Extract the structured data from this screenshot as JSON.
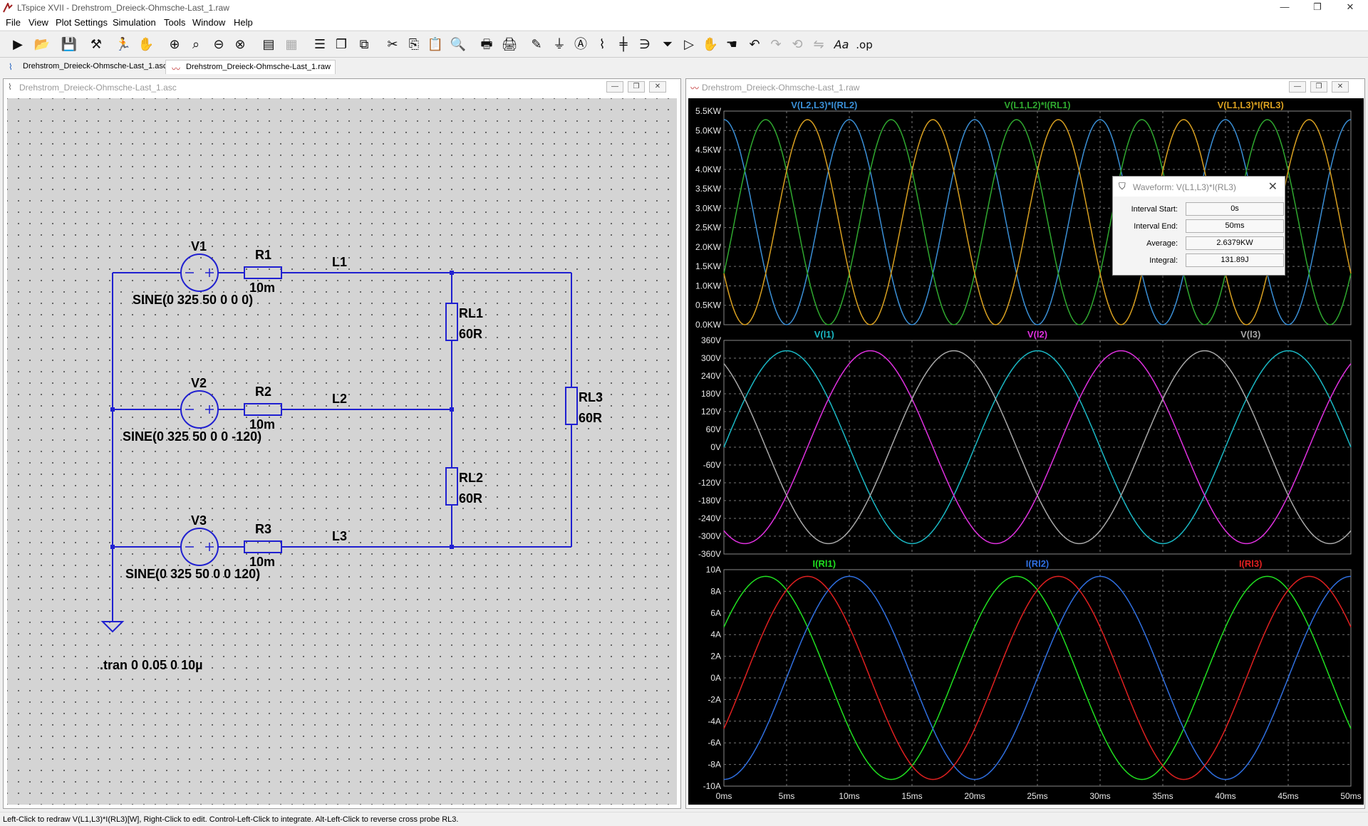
{
  "window": {
    "title": "LTspice XVII - Drehstrom_Dreieck-Ohmsche-Last_1.raw",
    "minimize": "—",
    "maximize": "❐",
    "close": "✕"
  },
  "menu": [
    "File",
    "View",
    "Plot Settings",
    "Simulation",
    "Tools",
    "Window",
    "Help"
  ],
  "doc_tabs": [
    {
      "label": "Drehstrom_Dreieck-Ohmsche-Last_1.asc",
      "icon": "schematic-icon"
    },
    {
      "label": "Drehstrom_Dreieck-Ohmsche-Last_1.raw",
      "icon": "waveform-icon"
    }
  ],
  "schematic_window": {
    "title": "Drehstrom_Dreieck-Ohmsche-Last_1.asc",
    "components": {
      "V1": {
        "name": "V1",
        "value": "SINE(0 325 50 0 0 0)"
      },
      "V2": {
        "name": "V2",
        "value": "SINE(0 325 50 0 0 -120)"
      },
      "V3": {
        "name": "V3",
        "value": "SINE(0 325 50 0 0 120)"
      },
      "R1": {
        "name": "R1",
        "value": "10m"
      },
      "R2": {
        "name": "R2",
        "value": "10m"
      },
      "R3": {
        "name": "R3",
        "value": "10m"
      },
      "RL1": {
        "name": "RL1",
        "value": "60R"
      },
      "RL2": {
        "name": "RL2",
        "value": "60R"
      },
      "RL3": {
        "name": "RL3",
        "value": "60R"
      }
    },
    "nets": {
      "L1": "L1",
      "L2": "L2",
      "L3": "L3"
    },
    "directive": ".tran 0 0.05 0 10µ"
  },
  "plot_window": {
    "title": "Drehstrom_Dreieck-Ohmsche-Last_1.raw"
  },
  "waveform_dialog": {
    "title": "Waveform: V(L1,L3)*I(RL3)",
    "rows": [
      {
        "label": "Interval Start:",
        "value": "0s"
      },
      {
        "label": "Interval End:",
        "value": "50ms"
      },
      {
        "label": "Average:",
        "value": "2.6379KW"
      },
      {
        "label": "Integral:",
        "value": "131.89J"
      }
    ]
  },
  "status_bar": "Left-Click to redraw V(L1,L3)*I(RL3)[W],  Right-Click to edit. Control-Left-Click to integrate. Alt-Left-Click to reverse cross probe RL3.",
  "chart_data": [
    {
      "type": "line",
      "pane": "power",
      "x_range": [
        0,
        50
      ],
      "x_unit": "ms",
      "x_ticks": [
        "0ms",
        "5ms",
        "10ms",
        "15ms",
        "20ms",
        "25ms",
        "30ms",
        "35ms",
        "40ms",
        "45ms",
        "50ms"
      ],
      "y_range": [
        0,
        5.5
      ],
      "y_unit": "KW",
      "y_ticks": [
        "5.5KW",
        "5.0KW",
        "4.5KW",
        "4.0KW",
        "3.5KW",
        "3.0KW",
        "2.5KW",
        "2.0KW",
        "1.5KW",
        "1.0KW",
        "0.5KW",
        "0.0KW"
      ],
      "grid": true,
      "series": [
        {
          "name": "V(L2,L3)*I(RL2)",
          "color": "#3a8fd6",
          "form": "sin_squared",
          "peak": 5.28,
          "phase_deg": 90
        },
        {
          "name": "V(L1,L2)*I(RL1)",
          "color": "#2fa82f",
          "form": "sin_squared",
          "peak": 5.28,
          "phase_deg": 30
        },
        {
          "name": "V(L1,L3)*I(RL3)",
          "color": "#d9a020",
          "form": "sin_squared",
          "peak": 5.28,
          "phase_deg": -30
        }
      ]
    },
    {
      "type": "line",
      "pane": "voltage",
      "x_range": [
        0,
        50
      ],
      "x_unit": "ms",
      "y_range": [
        -360,
        360
      ],
      "y_unit": "V",
      "y_ticks": [
        "360V",
        "300V",
        "240V",
        "180V",
        "120V",
        "60V",
        "0V",
        "-60V",
        "-120V",
        "-180V",
        "-240V",
        "-300V",
        "-360V"
      ],
      "grid": true,
      "series": [
        {
          "name": "V(l1)",
          "color": "#1ab8c4",
          "form": "sine",
          "peak": 325,
          "phase_deg": 0
        },
        {
          "name": "V(l2)",
          "color": "#e030e0",
          "form": "sine",
          "peak": 325,
          "phase_deg": -120
        },
        {
          "name": "V(l3)",
          "color": "#a8a8a8",
          "form": "sine",
          "peak": 325,
          "phase_deg": 120
        }
      ]
    },
    {
      "type": "line",
      "pane": "current",
      "x_range": [
        0,
        50
      ],
      "x_unit": "ms",
      "y_range": [
        -10,
        10
      ],
      "y_unit": "A",
      "y_ticks": [
        "10A",
        "8A",
        "6A",
        "4A",
        "2A",
        "0A",
        "-2A",
        "-4A",
        "-6A",
        "-8A",
        "-10A"
      ],
      "grid": true,
      "series": [
        {
          "name": "I(Rl1)",
          "color": "#20e020",
          "form": "sine",
          "peak": 9.38,
          "phase_deg": 30
        },
        {
          "name": "I(Rl2)",
          "color": "#2f6fe0",
          "form": "sine",
          "peak": 9.38,
          "phase_deg": -90
        },
        {
          "name": "I(Rl3)",
          "color": "#e02020",
          "form": "sine",
          "peak": 9.38,
          "phase_deg": -30
        }
      ]
    }
  ]
}
